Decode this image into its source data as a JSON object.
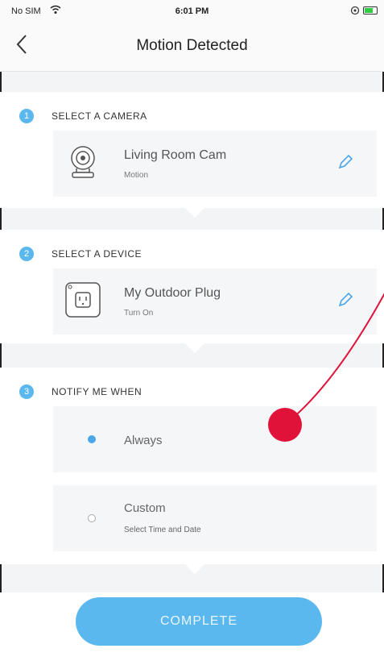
{
  "status_bar": {
    "carrier": "No SIM",
    "time": "6:01 PM"
  },
  "header": {
    "title": "Motion Detected"
  },
  "steps": [
    {
      "number": "1",
      "title": "SELECT A CAMERA",
      "item": {
        "name": "Living Room Cam",
        "action": "Motion",
        "icon": "camera-icon"
      }
    },
    {
      "number": "2",
      "title": "SELECT A DEVICE",
      "item": {
        "name": "My Outdoor Plug",
        "action": "Turn On",
        "icon": "plug-icon"
      }
    },
    {
      "number": "3",
      "title": "NOTIFY ME WHEN",
      "options": [
        {
          "label": "Always",
          "selected": true
        },
        {
          "label": "Custom",
          "sublabel": "Select Time and Date",
          "selected": false
        }
      ]
    }
  ],
  "footer": {
    "complete_label": "COMPLETE"
  },
  "colors": {
    "accent": "#5ab8ee",
    "annotation": "#e0123a"
  }
}
